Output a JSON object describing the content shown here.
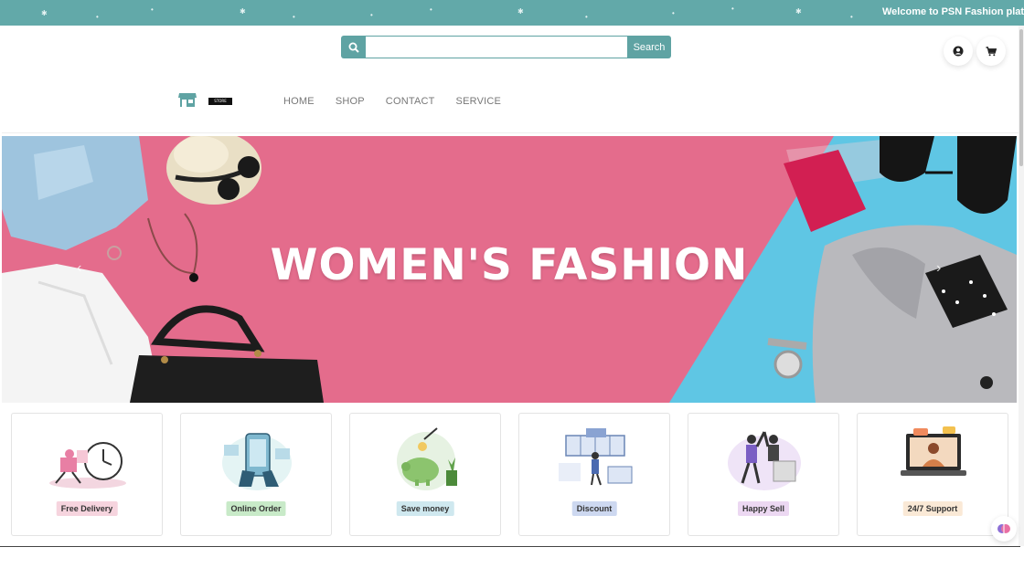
{
  "topbar": {
    "marquee_text": "Welcome to PSN Fashion platf",
    "bg_color": "#62a9a9"
  },
  "header": {
    "search": {
      "placeholder": "",
      "value": "",
      "button_label": "Search",
      "icon": "search-icon"
    },
    "account_icon": "user-circle-icon",
    "cart_icon": "cart-icon",
    "logo_icon": "store-icon",
    "logo_text": "STORE"
  },
  "nav": {
    "items": [
      {
        "label": "HOME"
      },
      {
        "label": "SHOP"
      },
      {
        "label": "CONTACT"
      },
      {
        "label": "SERVICE"
      }
    ]
  },
  "hero": {
    "title": "WOMEN'S FASHION",
    "bg_color": "#e46c8c",
    "accent_color": "#5fc6e4",
    "prev_icon": "chevron-left-icon",
    "next_icon": "chevron-right-icon"
  },
  "features": [
    {
      "label": "Free Delivery",
      "badge_color": "#f6d4de",
      "icon": "delivery-clock-icon"
    },
    {
      "label": "Online Order",
      "badge_color": "#c8eac8",
      "icon": "phone-order-icon"
    },
    {
      "label": "Save money",
      "badge_color": "#cfe8ef",
      "icon": "piggy-bank-icon"
    },
    {
      "label": "Discount",
      "badge_color": "#cdd8f0",
      "icon": "discount-store-icon"
    },
    {
      "label": "Happy Sell",
      "badge_color": "#ecd8f2",
      "icon": "high-five-icon"
    },
    {
      "label": "24/7 Support",
      "badge_color": "#fae9d6",
      "icon": "support-laptop-icon"
    }
  ],
  "floating_icon": "brain-icon"
}
